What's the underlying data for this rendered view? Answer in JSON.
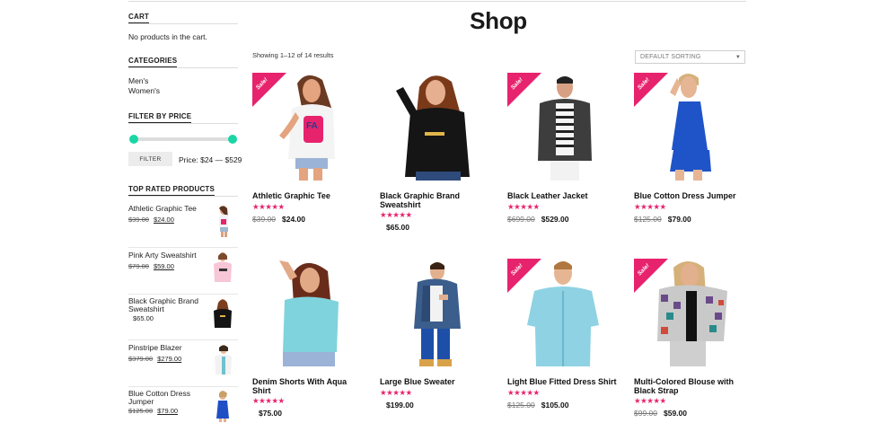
{
  "sidebar": {
    "cart_title": "CART",
    "cart_text": "No products in the cart.",
    "categories_title": "CATEGORIES",
    "categories": [
      "Men's",
      "Women's"
    ],
    "filter_title": "FILTER BY PRICE",
    "filter_button": "FILTER",
    "price_range": "Price: $24 — $529",
    "price_min": 24,
    "price_max": 529,
    "top_rated_title": "TOP RATED PRODUCTS",
    "top_rated": [
      {
        "name": "Athletic Graphic Tee",
        "old": "$39.00",
        "new": "$24.00"
      },
      {
        "name": "Pink Arty Sweatshirt",
        "old": "$79.00",
        "new": "$59.00"
      },
      {
        "name": "Black Graphic Brand Sweatshirt",
        "old": "",
        "new": "$65.00"
      },
      {
        "name": "Pinstripe Blazer",
        "old": "$379.00",
        "new": "$279.00"
      },
      {
        "name": "Blue Cotton Dress Jumper",
        "old": "$125.00",
        "new": "$79.00"
      }
    ]
  },
  "main": {
    "title": "Shop",
    "result_count": "Showing 1–12 of 14 results",
    "sorting": "DEFAULT SORTING",
    "sale_label": "Sale!",
    "rating_stars": "★★★★★",
    "rating": 5,
    "products": [
      {
        "name": "Athletic Graphic Tee",
        "old": "$39.00",
        "new": "$24.00",
        "sale": true
      },
      {
        "name": "Black Graphic Brand Sweatshirt",
        "old": "",
        "new": "$65.00",
        "sale": false
      },
      {
        "name": "Black Leather Jacket",
        "old": "$699.00",
        "new": "$529.00",
        "sale": true
      },
      {
        "name": "Blue Cotton Dress Jumper",
        "old": "$125.00",
        "new": "$79.00",
        "sale": true
      },
      {
        "name": "Denim Shorts With Aqua Shirt",
        "old": "",
        "new": "$75.00",
        "sale": false
      },
      {
        "name": "Large Blue Sweater",
        "old": "",
        "new": "$199.00",
        "sale": false
      },
      {
        "name": "Light Blue Fitted Dress Shirt",
        "old": "$125.00",
        "new": "$105.00",
        "sale": true
      },
      {
        "name": "Multi-Colored Blouse with Black Strap",
        "old": "$99.00",
        "new": "$59.00",
        "sale": true
      }
    ]
  },
  "colors": {
    "accent": "#e7236d",
    "slider": "#1ad6a5"
  }
}
